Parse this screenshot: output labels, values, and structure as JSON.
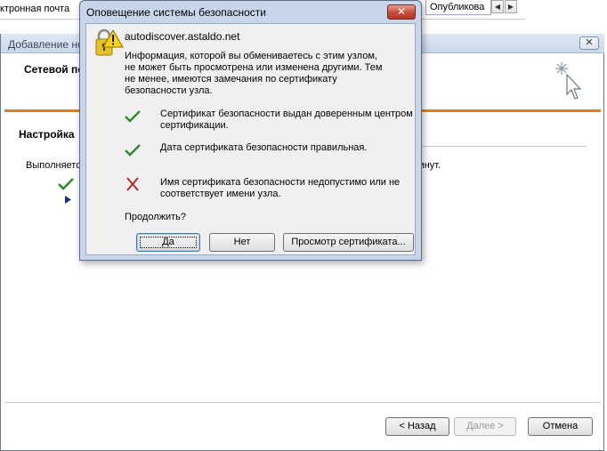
{
  "background": {
    "mail_text": "ктронная почта",
    "published_tab": "Опубликова",
    "scroll_left_icon": "arrow-left-icon",
    "scroll_right_icon": "arrow-right-icon"
  },
  "wizard": {
    "title": "Добавление но",
    "close_label": "✕",
    "header_title": "Сетевой по",
    "settings_title": "Настройка",
    "executing_text": "Выполняется",
    "minutes_text": "минут.",
    "buttons": {
      "back": "< Назад",
      "next": "Далее >",
      "cancel": "Отмена"
    },
    "colors": {
      "accent_rule": "#e67c1e"
    }
  },
  "dialog": {
    "title": "Оповещение системы безопасности",
    "close_label": "✕",
    "host": "autodiscover.astaldo.net",
    "info_text": "Информация, которой вы обмениваетесь с этим узлом, не может быть просмотрена или изменена другими. Тем не менее, имеются замечания по сертификату безопасности узла.",
    "items": [
      {
        "status": "ok",
        "icon": "checkmark-icon",
        "text": "Сертификат безопасности выдан доверенным центром сертификации."
      },
      {
        "status": "ok",
        "icon": "checkmark-icon",
        "text": "Дата сертификата безопасности правильная."
      },
      {
        "status": "error",
        "icon": "red-x-icon",
        "text": "Имя сертификата безопасности недопустимо или не соответствует имени узла."
      }
    ],
    "question": "Продолжить?",
    "buttons": {
      "yes": "Да",
      "no": "Нет",
      "view_cert": "Просмотр сертификата..."
    },
    "colors": {
      "ok": "#2e8b2e",
      "error": "#b02a2a"
    }
  }
}
